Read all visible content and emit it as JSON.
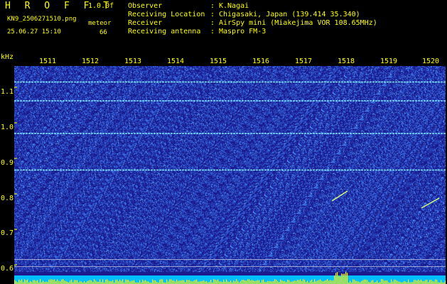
{
  "header": {
    "brand": "H R O F F T",
    "version": "1.0.0f",
    "filename": "KN9_2506271510.png",
    "timestamp": "25.06.27 15:10",
    "meteor_label": "meteor",
    "meteor_count": "66"
  },
  "meta": [
    {
      "key": "Observer",
      "sep": ":",
      "value": "K.Nagai"
    },
    {
      "key": "Receiving Location",
      "sep": ":",
      "value": "Chigasaki, Japan (139.414 35.340)"
    },
    {
      "key": "Receiver",
      "sep": ":",
      "value": "AirSpy mini (Miakejima VOR 108.65MHz)"
    },
    {
      "key": "Receiving antenna",
      "sep": ":",
      "value": "Maspro FM-3"
    }
  ],
  "chart_data": {
    "type": "heatmap",
    "x_ticks": [
      "1511",
      "1512",
      "1513",
      "1514",
      "1515",
      "1516",
      "1517",
      "1518",
      "1519",
      "1520"
    ],
    "y_unit": "kHz",
    "y_ticks": [
      "1.1",
      "1.0",
      "0.9",
      "0.8",
      "0.7",
      "0.6"
    ],
    "y_tick_values": [
      1.1,
      1.0,
      0.9,
      0.8,
      0.7,
      0.6
    ],
    "ylim": [
      0.58,
      1.16
    ],
    "carrier_lines_khz": [
      1.115,
      1.062,
      0.97,
      0.867
    ],
    "colors": {
      "background": "#1a1a8c",
      "noise": "#2e46c8",
      "signal": "#7fe8ff",
      "level": "#ffff00",
      "cyan_band": "#00bfff"
    }
  }
}
